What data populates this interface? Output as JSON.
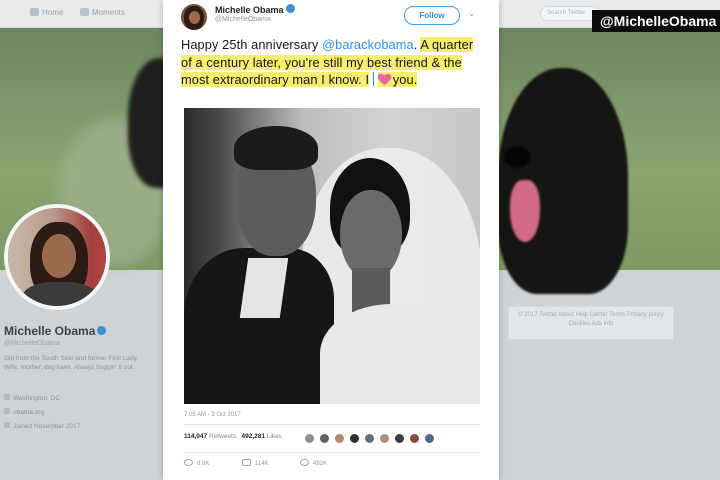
{
  "chyron": "@MichelleObama",
  "topbar": {
    "nav": [
      "Home",
      "Moments"
    ],
    "search_placeholder": "Search Twitter"
  },
  "profile": {
    "name": "Michelle Obama",
    "handle": "@MichelleObama",
    "bio": "Girl from the South Side and former First Lady. Wife, mother, dog lover. Always huggin' it out.",
    "location": "Washington, DC",
    "website": "obama.org",
    "joined": "Joined November 2017"
  },
  "right_footer": "© 2017 Twitter  About  Help Center  Terms  Privacy policy  Cookies  Ads info",
  "tweet": {
    "author_name": "Michelle Obama",
    "author_handle": "@MichelleObama",
    "follow_label": "Follow",
    "text_start": "Happy 25th anniversary ",
    "mention": "@barackobama",
    "text_mid": ". ",
    "text_highlight": "A quarter of a century later, you're still my best friend & the most extraordinary man I know. I",
    "text_end": "you.",
    "timestamp": "7:05 AM - 3 Oct 2017",
    "retweets_count": "114,047",
    "retweets_label": "Retweets",
    "likes_count": "492,281",
    "likes_label": "Likes",
    "reply_count": "8.9K",
    "retweet_action_count": "114K",
    "like_action_count": "492K"
  },
  "colors": {
    "accent": "#2a93e3",
    "highlight": "#f7ee6e",
    "heart": "#e06c9f",
    "chyron_bg": "#0c0c0c"
  }
}
